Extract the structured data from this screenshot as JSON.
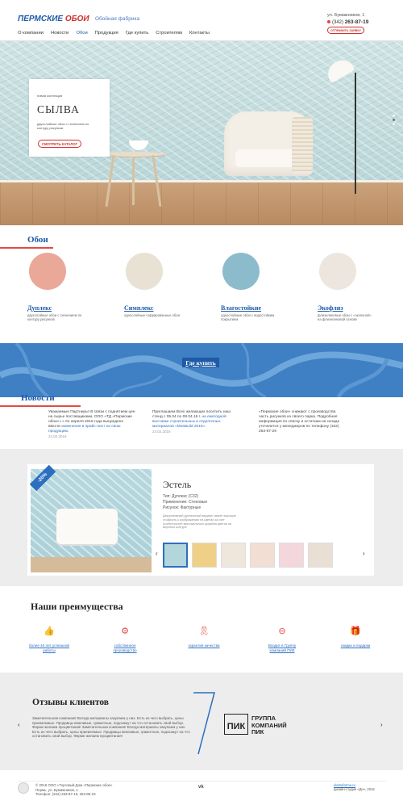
{
  "header": {
    "logo_part1": "ПЕРМСКИЕ",
    "logo_part2": "ОБОИ",
    "factory": "Обойная фабрика",
    "address": "ул. Бумажников, 1",
    "phone_prefix": "(342)",
    "phone": "263-87-19",
    "request_button": "ОТПРАВИТЬ ЗАЯВКУ"
  },
  "nav": [
    "О компании",
    "Новости",
    "Обои",
    "Продукция",
    "Где купить",
    "Строителям",
    "Контакты"
  ],
  "nav_active": "Обои",
  "hero": {
    "tag": "новая коллекция",
    "title": "СЫЛВА",
    "desc": "двухслойные обои с тиснением по контуру рисунков",
    "button": "СМОТРЕТЬ КАТАЛОГ",
    "slides_total": 3,
    "slide_active": 1
  },
  "wallpapers": {
    "title": "Обои",
    "items": [
      {
        "name": "Дуплекс",
        "desc": "двухслойные обои с тиснением по контуру рисунков",
        "color": "#e9a898"
      },
      {
        "name": "Симплекс",
        "desc": "однослойные гофрированные обои",
        "color": "#e8e1d4"
      },
      {
        "name": "Влагостойкие",
        "desc": "однослойные обои с водостойким покрытием",
        "color": "#8cbccb"
      },
      {
        "name": "Экофлиз",
        "desc": "флизелиновые обои с «экопеной» на флизелиновой основе",
        "color": "#ede6df"
      }
    ]
  },
  "map": {
    "button": "Где купить"
  },
  "news": {
    "title": "Новости",
    "items": [
      {
        "text": "Уважаемые Партнеры! В связи с поднятием цен на сырье поставщиками, ООО «ТД «Пермские обои»» с 01 апреля 2016 года вынуждено ввести",
        "link": "изменения в прайс-лист на свою продукцию.",
        "date": "24.02.2016"
      },
      {
        "text": "Приглашаем Всех желающих посетить наш стенд с 05.04 по 08.04.16 г.",
        "link": "на ежегодной выставке строительных и отделочных материалов «MosBuild 2016».",
        "date": "24.02.2016"
      },
      {
        "text": "«Пермские обои» снижают с производства часть рисунков из своего парка. Подробная информация по списку и остаткам на складе уточняется у менеджеров по телефону (342) 263-87-29",
        "link": "",
        "date": ""
      }
    ]
  },
  "product": {
    "discount": "-20%",
    "name": "Эстель",
    "specs": [
      "Тип: Дуплекс (С32)",
      "Применение: Стеновые",
      "Рисунок: Фактурные"
    ],
    "desc": "Декоративный дуплексный вариант имеет высокую стойкость к изображению на цветах за счет особенностей вертикального дизайна цветов на верхнем контуре",
    "prev": "‹",
    "next": "›",
    "thumbs": [
      {
        "color": "#b2d6dc"
      },
      {
        "color": "#f0cf86"
      },
      {
        "color": "#efe6dc"
      },
      {
        "color": "#f2ded3"
      },
      {
        "color": "#f4d7dc"
      },
      {
        "color": "#eadfd5"
      }
    ]
  },
  "advantages": {
    "title": "Наши преимущества",
    "items": [
      {
        "icon": "thumbs-up-icon",
        "glyph": "👍",
        "text": "более 40 лет успешной работы"
      },
      {
        "icon": "gear-icon",
        "glyph": "⚙",
        "text": "собственное производство"
      },
      {
        "icon": "award-icon",
        "glyph": "🎗",
        "text": "гарантия качества"
      },
      {
        "icon": "production-icon",
        "glyph": "⊖",
        "text": "Входит в Группу компаний ПИК"
      },
      {
        "icon": "gift-icon",
        "glyph": "🎁",
        "text": "скидки и подарки"
      }
    ]
  },
  "reviews": {
    "title": "Отзывы клиентов",
    "text": "Замечательная компания! Всегда материалы закупаем у них. Есть из чего выбрать, цены приемлемые. Продавцы вежливые, грамотные, подскажут на что остановить свой выбор. Фирме желаем процветания! Замечательная компания! Всегда материалы закупаем у них. Есть из чего выбрать, цены приемлемые. Продавцы вежливые, грамотные, подскажут на что остановить свой выбор. Фирме желаем процветания!",
    "logo": "ПИК",
    "logo_sub": "ГРУППА",
    "company_lines": [
      "ГРУППА",
      "КОМПАНИЙ",
      "ПИК"
    ],
    "prev": "‹",
    "next": "›"
  },
  "footer": {
    "copyright": "© 2016 ООО «Торговый Дом «Пермские обои»",
    "address": "Пермь, ул. Бумажников, 1",
    "phone": "Телефон: (342) 263-87-19, 263-86-23",
    "social": "vk",
    "studio_link": "ekstraforma.ru",
    "studio": "дизайн-студия «Дн», 2016"
  }
}
